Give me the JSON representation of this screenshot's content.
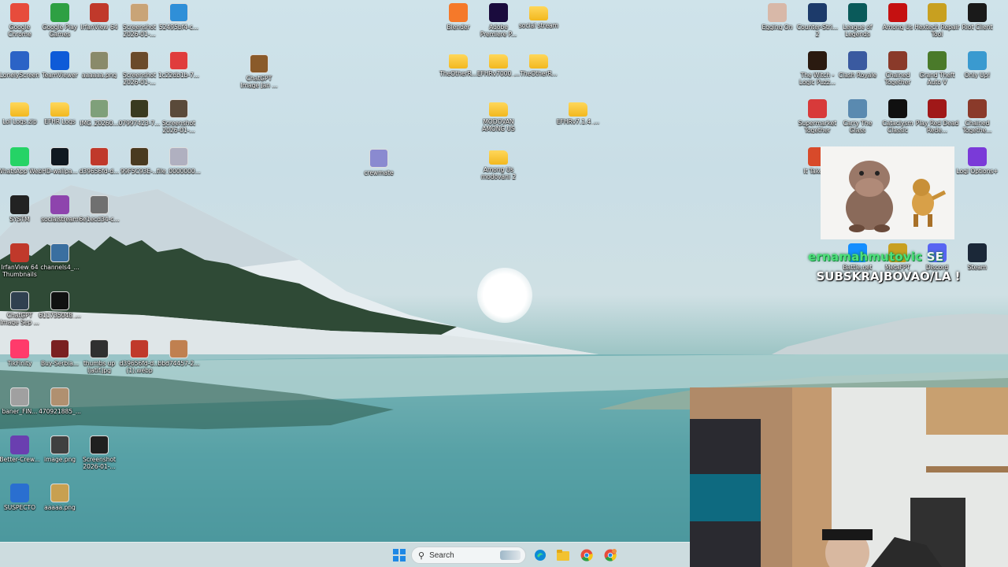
{
  "desktop": {
    "icons": [
      {
        "label": "Google Chrome",
        "icon": "chrome-icon",
        "color": "#e74c3c"
      },
      {
        "label": "Google Play Games",
        "icon": "play-games-icon",
        "color": "#2ea043"
      },
      {
        "label": "IrfanView 64",
        "icon": "irfanview-icon",
        "color": "#c0392b"
      },
      {
        "label": "Screenshot 2026-01-...",
        "icon": "image-file-icon",
        "color": "#c9a477"
      },
      {
        "label": "52495bf4-c...",
        "icon": "image-file-icon",
        "color": "#2f8fd8"
      },
      {
        "label": "LonelyScreen",
        "icon": "lonelyscreen-icon",
        "color": "#2b63c6"
      },
      {
        "label": "TeamViewer",
        "icon": "teamviewer-icon",
        "color": "#0e5bd8"
      },
      {
        "label": "aaaaaa.png",
        "icon": "image-file-icon",
        "color": "#8a8a6a"
      },
      {
        "label": "Screenshot 2026-01-...",
        "icon": "image-file-icon",
        "color": "#6b4a2a"
      },
      {
        "label": "1c22db1b-7...",
        "icon": "image-file-icon",
        "color": "#e03c3c"
      },
      {
        "label": "Lol Logs.zip",
        "icon": "zip-folder-icon",
        "color": "#f2c230"
      },
      {
        "label": "EFHR Logs",
        "icon": "folder-icon",
        "color": "#f2c230"
      },
      {
        "label": "IMG_20260...",
        "icon": "image-file-icon",
        "color": "#7fa07a"
      },
      {
        "label": "07997423-7...",
        "icon": "image-file-icon",
        "color": "#3a3a20"
      },
      {
        "label": "Screenshot 2026-01-...",
        "icon": "image-file-icon",
        "color": "#5a4a3a"
      },
      {
        "label": "WhatsApp Web",
        "icon": "whatsapp-icon",
        "color": "#25d366"
      },
      {
        "label": "HD-wallpa...",
        "icon": "image-file-icon",
        "color": "#101820"
      },
      {
        "label": "d39656fd-d...",
        "icon": "image-file-icon",
        "color": "#c0392b"
      },
      {
        "label": "99F5C93E-...",
        "icon": "image-file-icon",
        "color": "#4a3a20"
      },
      {
        "label": "file_0000000...",
        "icon": "image-file-icon",
        "color": "#b0b0c0"
      },
      {
        "label": "SYSTM",
        "icon": "systm-icon",
        "color": "#222222"
      },
      {
        "label": "socialstream",
        "icon": "socialstream-icon",
        "color": "#8e44ad"
      },
      {
        "label": "6e1ecd34-c...",
        "icon": "image-file-icon",
        "color": "#707070"
      },
      {
        "label": "IrfanView 64 Thumbnails",
        "icon": "irfanview-thumbnails-icon",
        "color": "#c0392b"
      },
      {
        "label": "channels4_...",
        "icon": "image-file-icon",
        "color": "#3a6fa0"
      },
      {
        "label": "ChatGPT Image Sep ...",
        "icon": "image-file-icon",
        "color": "#304050"
      },
      {
        "label": "611735048_...",
        "icon": "image-file-icon",
        "color": "#111111"
      },
      {
        "label": "TikFinity",
        "icon": "tikfinity-icon",
        "color": "#ff3b6b"
      },
      {
        "label": "Buy-Serbia...",
        "icon": "image-file-icon",
        "color": "#7a2020"
      },
      {
        "label": "thumbs up ljatif.jpg",
        "icon": "image-file-icon",
        "color": "#303030"
      },
      {
        "label": "d39656fd-d... (1).webp",
        "icon": "image-file-icon",
        "color": "#c0392b"
      },
      {
        "label": "bbd74457-2...",
        "icon": "image-file-icon",
        "color": "#c08050"
      },
      {
        "label": "baner_FIN...",
        "icon": "image-file-icon",
        "color": "#a0a0a0"
      },
      {
        "label": "470921885_...",
        "icon": "image-file-icon",
        "color": "#b09070"
      },
      {
        "label": "Better-Crew...",
        "icon": "bettercrew-icon",
        "color": "#6a3fb0"
      },
      {
        "label": "image.png",
        "icon": "image-file-icon",
        "color": "#404040"
      },
      {
        "label": "Screenshot 2026-01-...",
        "icon": "image-file-icon",
        "color": "#202020"
      },
      {
        "label": "SUSPECTO",
        "icon": "suspecto-icon",
        "color": "#2a6fd0"
      },
      {
        "label": "aaaaa.png",
        "icon": "image-file-icon",
        "color": "#c8a050"
      },
      {
        "label": "ChatGPT Image Jan ...",
        "icon": "image-file-icon",
        "color": "#8a5a2a"
      },
      {
        "label": "crewmate",
        "icon": "image-file-icon",
        "color": "#8a8ad0"
      },
      {
        "label": "Blender",
        "icon": "blender-icon",
        "color": "#f5792a"
      },
      {
        "label": "Adobe Premiere P...",
        "icon": "premiere-icon",
        "color": "#1a0b3d"
      },
      {
        "label": "social stream",
        "icon": "folder-icon",
        "color": "#f2c230"
      },
      {
        "label": "TheOtherR...",
        "icon": "folder-icon",
        "color": "#f2c230"
      },
      {
        "label": "EFHRv7000_...",
        "icon": "folder-icon",
        "color": "#f2c230"
      },
      {
        "label": "TheOtherR...",
        "icon": "folder-icon",
        "color": "#f2c230"
      },
      {
        "label": "MODOVAN AMONG US",
        "icon": "folder-icon",
        "color": "#f2c230"
      },
      {
        "label": "EFHRv7.1.4_...",
        "icon": "folder-icon",
        "color": "#f2c230"
      },
      {
        "label": "Among Us modovani 2",
        "icon": "folder-icon",
        "color": "#f2c230"
      },
      {
        "label": "Egging On",
        "icon": "egging-on-icon",
        "color": "#d8b8a8"
      },
      {
        "label": "Counter-Stri... 2",
        "icon": "counter-strike-icon",
        "color": "#1c3a6a"
      },
      {
        "label": "League of Legends",
        "icon": "league-icon",
        "color": "#0a5a5a"
      },
      {
        "label": "Among Us",
        "icon": "among-us-icon",
        "color": "#c51111"
      },
      {
        "label": "Hextech Repair Tool",
        "icon": "hextech-icon",
        "color": "#c8a020"
      },
      {
        "label": "Riot Client",
        "icon": "riot-client-icon",
        "color": "#1a1a1a"
      },
      {
        "label": "The Witch - Logic Puzz...",
        "icon": "game-icon",
        "color": "#2a1a10"
      },
      {
        "label": "Clash Royale",
        "icon": "clash-royale-icon",
        "color": "#3a5aa0"
      },
      {
        "label": "Chained Together",
        "icon": "chained-together-icon",
        "color": "#8a3a2a"
      },
      {
        "label": "Grand Theft Auto V",
        "icon": "gta-icon",
        "color": "#4a7a2a"
      },
      {
        "label": "Only Up!",
        "icon": "only-up-icon",
        "color": "#3a9ad0"
      },
      {
        "label": "Supermarket Together",
        "icon": "supermarket-icon",
        "color": "#d83a3a"
      },
      {
        "label": "Carry The Glass",
        "icon": "carry-glass-icon",
        "color": "#5a8ab0"
      },
      {
        "label": "Cataclysm Classic",
        "icon": "wow-icon",
        "color": "#101010"
      },
      {
        "label": "Play Red Dead Rede...",
        "icon": "red-dead-icon",
        "color": "#a01818"
      },
      {
        "label": "Chained Togethe...",
        "icon": "chained-together-icon",
        "color": "#8a3a2a"
      },
      {
        "label": "It Takes...",
        "icon": "it-takes-two-icon",
        "color": "#d84a2a"
      },
      {
        "label": "Logi Options+",
        "icon": "logi-options-icon",
        "color": "#7a3ad8"
      },
      {
        "label": "Battle.net",
        "icon": "battlenet-icon",
        "color": "#148eff"
      },
      {
        "label": "MetaFPT",
        "icon": "metafpt-icon",
        "color": "#c8a020"
      },
      {
        "label": "Discord",
        "icon": "discord-icon",
        "color": "#5865f2"
      },
      {
        "label": "Steam",
        "icon": "steam-icon",
        "color": "#1b2838"
      }
    ]
  },
  "overlay": {
    "subscriber_name": "ernamahmutovic",
    "subscriber_suffix": " SE",
    "subscribe_text": "SUBSKRAJBOVAO/LA !"
  },
  "taskbar": {
    "search_placeholder": "Search",
    "items": [
      {
        "icon": "windows-start-icon",
        "color": "#1e88e5"
      },
      {
        "icon": "edge-icon",
        "color": "#0c8ad6"
      },
      {
        "icon": "file-explorer-icon",
        "color": "#f2c230"
      },
      {
        "icon": "chrome-icon",
        "color": "#e74c3c"
      },
      {
        "icon": "chrome-profile-icon",
        "color": "#e74c3c"
      }
    ]
  }
}
